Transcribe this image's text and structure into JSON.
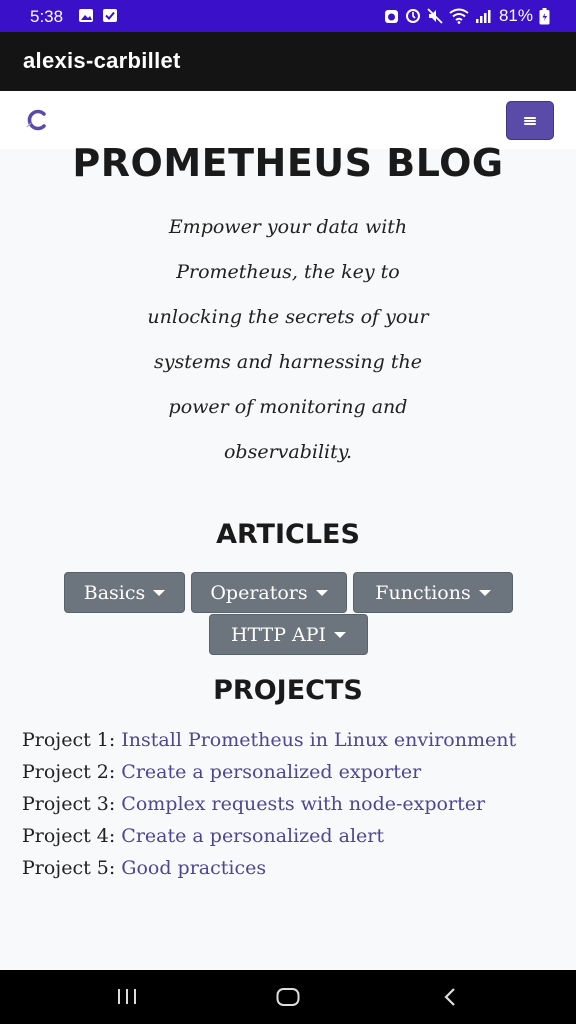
{
  "status_bar": {
    "time": "5:38",
    "battery": "81%",
    "icons": [
      "gallery-icon",
      "checkbox-icon",
      "alarm-icon",
      "mute-icon",
      "wifi-icon",
      "signal-icon",
      "battery-icon"
    ]
  },
  "app_bar": {
    "title": "alexis-carbillet"
  },
  "navbar": {
    "logo_text": "C",
    "menu_icon": "hamburger-icon",
    "accent_color": "#5a4ba8"
  },
  "hero": {
    "title": "PROMETHEUS BLOG",
    "tagline": "Empower your data with Prometheus, the key to unlocking the secrets of your systems and harnessing the power of monitoring and observability."
  },
  "articles": {
    "heading": "ARTICLES",
    "buttons": [
      "Basics",
      "Operators",
      "Functions",
      "HTTP API"
    ]
  },
  "projects": {
    "heading": "PROJECTS",
    "items": [
      {
        "prefix": "Project 1: ",
        "link": "Install Prometheus in Linux environment"
      },
      {
        "prefix": "Project 2: ",
        "link": "Create a personalized exporter"
      },
      {
        "prefix": "Project 3: ",
        "link": "Complex requests with node-exporter"
      },
      {
        "prefix": "Project 4: ",
        "link": "Create a personalized alert"
      },
      {
        "prefix": "Project 5: ",
        "link": "Good practices"
      }
    ]
  },
  "system_nav": [
    "recent-apps-icon",
    "home-icon",
    "back-icon"
  ]
}
